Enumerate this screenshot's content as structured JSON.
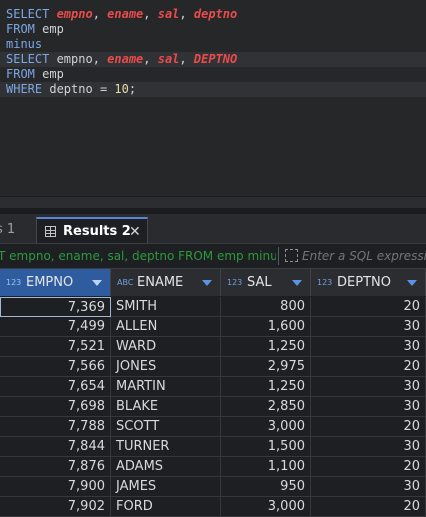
{
  "editor": {
    "lines": [
      [
        {
          "t": "SELECT ",
          "c": "kw"
        },
        {
          "t": "empno",
          "c": "red"
        },
        {
          "t": ", ",
          "c": "punc"
        },
        {
          "t": "ename",
          "c": "red"
        },
        {
          "t": ", ",
          "c": "punc"
        },
        {
          "t": "sal",
          "c": "red"
        },
        {
          "t": ", ",
          "c": "punc"
        },
        {
          "t": "deptno",
          "c": "red"
        }
      ],
      [
        {
          "t": "FROM ",
          "c": "kw"
        },
        {
          "t": "emp",
          "c": "id"
        }
      ],
      [
        {
          "t": "minus",
          "c": "kw"
        }
      ],
      [
        {
          "t": "SELECT ",
          "c": "kw"
        },
        {
          "t": "empno",
          "c": "id"
        },
        {
          "t": ", ",
          "c": "punc"
        },
        {
          "t": "ename",
          "c": "red"
        },
        {
          "t": ", ",
          "c": "punc"
        },
        {
          "t": "sal",
          "c": "red"
        },
        {
          "t": ", ",
          "c": "punc"
        },
        {
          "t": "DEPTNO",
          "c": "red"
        }
      ],
      [
        {
          "t": "FROM ",
          "c": "kw"
        },
        {
          "t": "emp",
          "c": "id"
        }
      ],
      [
        {
          "t": "WHERE ",
          "c": "kw"
        },
        {
          "t": "deptno",
          "c": "id"
        },
        {
          "t": " = ",
          "c": "punc"
        },
        {
          "t": "10",
          "c": "num"
        },
        {
          "t": ";",
          "c": "punc"
        }
      ]
    ]
  },
  "tabs": {
    "inactive_label": "s 1",
    "active_label": "Results 2",
    "close_glyph": "✕"
  },
  "filter": {
    "query_text": "T empno, ename, sal, deptno FROM emp minus",
    "placeholder": "Enter a SQL expression"
  },
  "grid": {
    "columns": [
      {
        "type": "123",
        "label": "EMPNO"
      },
      {
        "type": "ABC",
        "label": "ENAME"
      },
      {
        "type": "123",
        "label": "SAL"
      },
      {
        "type": "123",
        "label": "DEPTNO"
      }
    ],
    "rows": [
      [
        "7,369",
        "SMITH",
        "800",
        "20"
      ],
      [
        "7,499",
        "ALLEN",
        "1,600",
        "30"
      ],
      [
        "7,521",
        "WARD",
        "1,250",
        "30"
      ],
      [
        "7,566",
        "JONES",
        "2,975",
        "20"
      ],
      [
        "7,654",
        "MARTIN",
        "1,250",
        "30"
      ],
      [
        "7,698",
        "BLAKE",
        "2,850",
        "30"
      ],
      [
        "7,788",
        "SCOTT",
        "3,000",
        "20"
      ],
      [
        "7,844",
        "TURNER",
        "1,500",
        "30"
      ],
      [
        "7,876",
        "ADAMS",
        "1,100",
        "20"
      ],
      [
        "7,900",
        "JAMES",
        "950",
        "30"
      ],
      [
        "7,902",
        "FORD",
        "3,000",
        "20"
      ]
    ]
  },
  "colors": {
    "keyword": "#7da7e3",
    "highlight_identifier": "#ea4b4b",
    "active_tab_accent": "#5786d6",
    "selected_column_header": "#2f5c9e",
    "filter_text": "#2c9a3c"
  }
}
